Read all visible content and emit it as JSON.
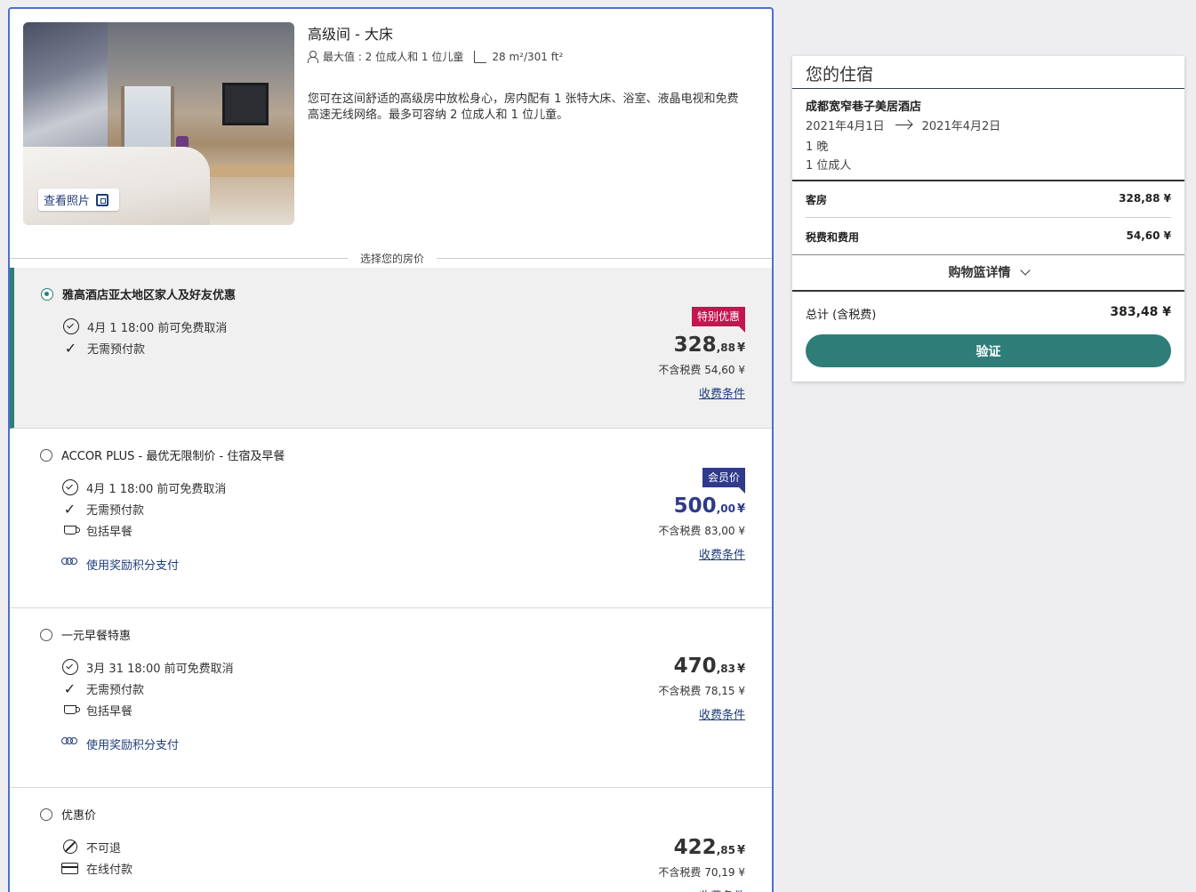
{
  "room": {
    "title": "高级间 - 大床",
    "capacity": "最大值 : 2 位成人和 1 位儿童",
    "area": "28 m²/301 ft²",
    "description": "您可在这间舒适的高级房中放松身心，房内配有 1 张特大床、浴室、液晶电视和免费高速无线网络。最多可容纳 2 位成人和 1 位儿童。",
    "view_photos": "查看照片"
  },
  "section_label": "选择您的房价",
  "rates": [
    {
      "name": "雅高酒店亚太地区家人及好友优惠",
      "selected": true,
      "features": [
        {
          "icon": "clock-check-icon",
          "text": "4月 1 18:00 前可免费取消"
        },
        {
          "icon": "check-icon",
          "text": "无需预付款"
        }
      ],
      "points_label": "",
      "badge": "特别优惠",
      "badge_color": "#c4154f",
      "price_int": "328",
      "price_dec": ",88",
      "currency": "¥",
      "tax": "不含税费 54,60 ¥",
      "terms": "收费条件"
    },
    {
      "name": "ACCOR PLUS - 最优无限制价 - 住宿及早餐",
      "selected": false,
      "features": [
        {
          "icon": "clock-check-icon",
          "text": "4月 1 18:00 前可免费取消"
        },
        {
          "icon": "check-icon",
          "text": "无需预付款"
        },
        {
          "icon": "cup-icon",
          "text": "包括早餐"
        }
      ],
      "points_label": "使用奖励积分支付",
      "badge": "会员价",
      "badge_color": "#2f3a8a",
      "price_int": "500",
      "price_dec": ",00",
      "currency": "¥",
      "tax": "不含税费 83,00 ¥",
      "terms": "收费条件"
    },
    {
      "name": "一元早餐特惠",
      "selected": false,
      "features": [
        {
          "icon": "clock-check-icon",
          "text": "3月 31 18:00 前可免费取消"
        },
        {
          "icon": "check-icon",
          "text": "无需预付款"
        },
        {
          "icon": "cup-icon",
          "text": "包括早餐"
        }
      ],
      "points_label": "使用奖励积分支付",
      "badge": "",
      "price_int": "470",
      "price_dec": ",83",
      "currency": "¥",
      "tax": "不含税费 78,15 ¥",
      "terms": "收费条件"
    },
    {
      "name": "优惠价",
      "selected": false,
      "features": [
        {
          "icon": "no-refund-icon",
          "text": "不可退"
        },
        {
          "icon": "card-icon",
          "text": "在线付款"
        }
      ],
      "points_label": "",
      "badge": "",
      "price_int": "422",
      "price_dec": ",85",
      "currency": "¥",
      "tax": "不含税费 70,19 ¥",
      "terms": "收费条件"
    }
  ],
  "summary": {
    "title": "您的住宿",
    "hotel": "成都宽窄巷子美居酒店",
    "checkin": "2021年4月1日",
    "checkout": "2021年4月2日",
    "nights": "1 晚",
    "adults": "1 位成人",
    "room_label": "客房",
    "room_value": "328,88 ¥",
    "tax_label": "税费和费用",
    "tax_value": "54,60 ¥",
    "cart_details": "购物篮详情",
    "total_label": "总计 (含税费)",
    "total_value": "383,48 ¥",
    "verify_button": "验证"
  },
  "colors": {
    "accent": "#2e7d78",
    "panel_border": "#4a6fd1",
    "special_badge": "#c4154f",
    "member_badge": "#2f3a8a",
    "link": "#1f3d7a"
  }
}
